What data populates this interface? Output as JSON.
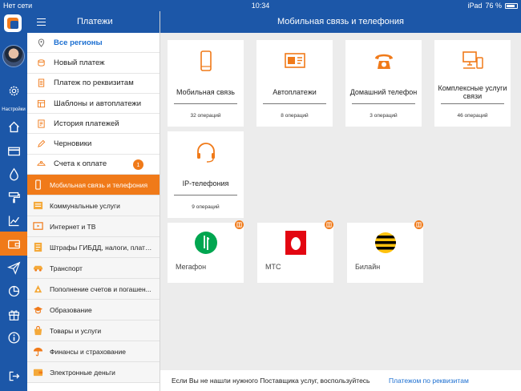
{
  "status_bar": {
    "carrier": "Нет сети",
    "time": "10:34",
    "battery": "76 %",
    "device": "iPad"
  },
  "rail": {
    "settings_label": "Настройки",
    "items": [
      "home-icon",
      "card-icon",
      "drop-icon",
      "roller-icon",
      "chart-icon",
      "wallet-icon",
      "send-icon",
      "pie-icon",
      "gift-icon",
      "info-icon",
      "exit-icon"
    ]
  },
  "sidebar": {
    "title": "Платежи",
    "menu": [
      {
        "label": "Все регионы",
        "icon": "location-icon"
      },
      {
        "label": "Новый платеж",
        "icon": "coins-icon"
      },
      {
        "label": "Платеж по реквизитам",
        "icon": "document-icon"
      },
      {
        "label": "Шаблоны и автоплатежи",
        "icon": "template-icon"
      },
      {
        "label": "История платежей",
        "icon": "history-icon"
      },
      {
        "label": "Черновики",
        "icon": "pencil-icon"
      },
      {
        "label": "Счета к оплате",
        "icon": "bill-icon",
        "badge": "1"
      }
    ],
    "categories": [
      {
        "label": "Мобильная связь и телефония",
        "icon": "phone-icon",
        "active": true
      },
      {
        "label": "Коммунальные услуги",
        "icon": "utilities-icon"
      },
      {
        "label": "Интернет и ТВ",
        "icon": "tv-icon"
      },
      {
        "label": "Штрафы ГИБДД, налоги, плате...",
        "icon": "fines-icon"
      },
      {
        "label": "Транспорт",
        "icon": "car-icon"
      },
      {
        "label": "Пополнение счетов и погашен...",
        "icon": "refill-icon"
      },
      {
        "label": "Образование",
        "icon": "education-icon"
      },
      {
        "label": "Товары и услуги",
        "icon": "shopping-icon"
      },
      {
        "label": "Финансы и страхование",
        "icon": "umbrella-icon"
      },
      {
        "label": "Электронные деньги",
        "icon": "emoney-icon"
      }
    ]
  },
  "main": {
    "title": "Мобильная связь и телефония",
    "tiles": [
      {
        "label": "Мобильная связь",
        "count": "32 операций",
        "icon": "mobile-icon"
      },
      {
        "label": "Автоплатежи",
        "count": "8 операций",
        "icon": "autopay-icon"
      },
      {
        "label": "Домашний телефон",
        "count": "3 операций",
        "icon": "home-phone-icon"
      },
      {
        "label": "Комплексные услуги связи",
        "count": "46 операций",
        "icon": "complex-services-icon"
      },
      {
        "label": "IP-телефония",
        "count": "9 операций",
        "icon": "headset-icon"
      }
    ],
    "providers": [
      {
        "name": "Мегафон",
        "icon": "megafon-logo"
      },
      {
        "name": "МТС",
        "icon": "mts-logo"
      },
      {
        "name": "Билайн",
        "icon": "beeline-logo"
      }
    ],
    "footer_text": "Если Вы не нашли нужного Поставщика услуг, воспользуйтесь",
    "footer_link": "Платежом по реквизитам"
  },
  "colors": {
    "brand_blue": "#1c57a8",
    "accent_orange": "#f07a19",
    "link_blue": "#1c6fd1"
  }
}
